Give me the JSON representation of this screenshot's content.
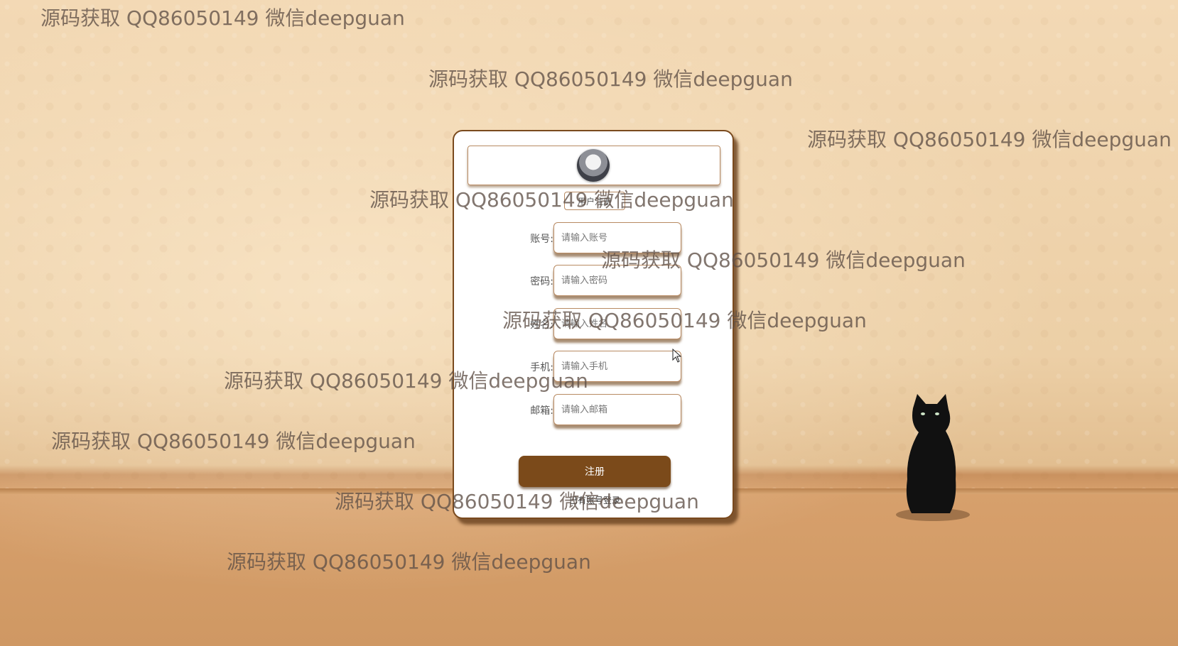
{
  "watermark_text": "源码获取 QQ86050149 微信deepguan",
  "register_form": {
    "role_button": "用户注册",
    "fields": [
      {
        "label": "账号:",
        "placeholder": "请输入账号"
      },
      {
        "label": "密码:",
        "placeholder": "请输入密码"
      },
      {
        "label": "姓名:",
        "placeholder": "请输入姓名"
      },
      {
        "label": "手机:",
        "placeholder": "请输入手机"
      },
      {
        "label": "邮箱:",
        "placeholder": "请输入邮箱"
      }
    ],
    "submit_label": "注册",
    "login_link": "已有账号登录"
  },
  "colors": {
    "accent": "#7b4a1a",
    "card_border": "#7a4a1e",
    "wall": "#f3d9b5",
    "floor": "#cf9863",
    "watermark": "#5f5046"
  },
  "icons": [
    "avatar-image",
    "cat-image",
    "mouse-cursor-icon"
  ]
}
